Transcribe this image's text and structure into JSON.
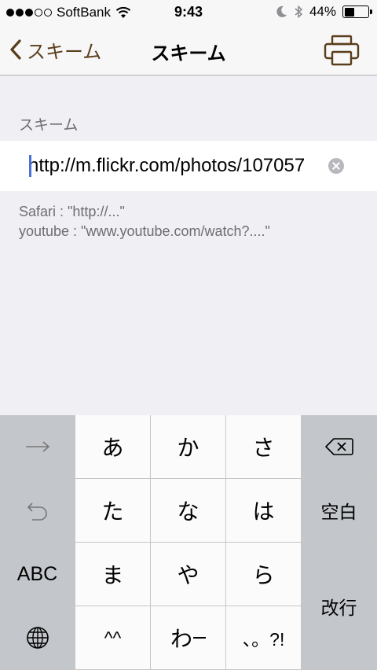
{
  "status_bar": {
    "carrier": "SoftBank",
    "time": "9:43",
    "battery_percent": "44%",
    "battery_level": 0.44,
    "icons": [
      "signal-dots-icon",
      "wifi-icon",
      "moon-icon",
      "bluetooth-icon",
      "battery-icon"
    ]
  },
  "nav": {
    "back_label": "スキーム",
    "title": "スキーム",
    "print_icon": "print-icon"
  },
  "form": {
    "section_header": "スキーム",
    "url_value": "http://m.flickr.com/photos/107057",
    "hint_line1": "Safari : \"http://...\"",
    "hint_line2": "youtube : \"www.youtube.com/watch?....\""
  },
  "keyboard": {
    "next_icon": "arrow-right-icon",
    "undo_icon": "undo-icon",
    "backspace_icon": "backspace-icon",
    "globe_icon": "globe-icon",
    "keys": {
      "a": "あ",
      "ka": "か",
      "sa": "さ",
      "ta": "た",
      "na": "な",
      "ha": "は",
      "ma": "ま",
      "ya": "や",
      "ra": "ら",
      "emoticon": "^^",
      "wa": "わ",
      "punct": "、。?!"
    },
    "space": "空白",
    "abc": "ABC",
    "enter": "改行"
  },
  "colors": {
    "accent_brown": "#5a3e1b",
    "background": "#efeff4",
    "caret_blue": "#4a72d6"
  }
}
